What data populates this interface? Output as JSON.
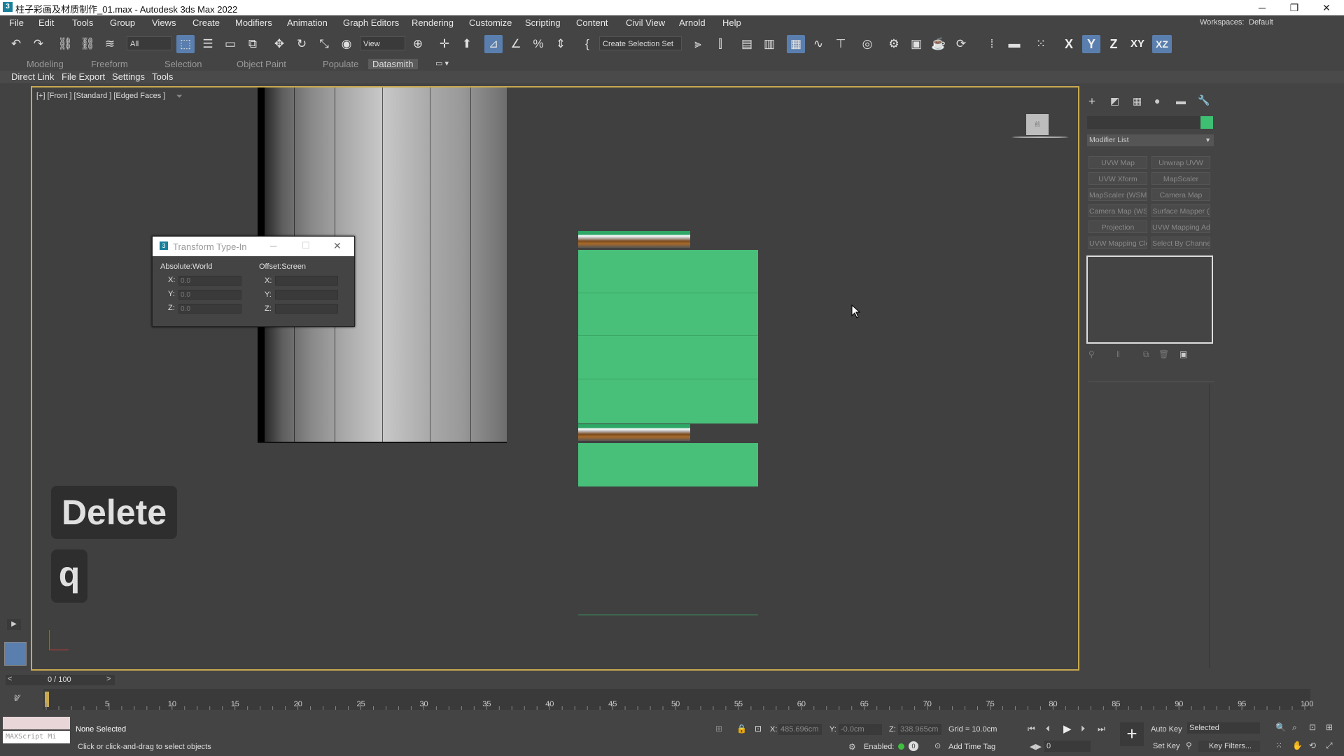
{
  "window": {
    "title": "柱子彩画及材质制作_01.max - Autodesk 3ds Max 2022",
    "app_icon": "3",
    "minimize": "─",
    "restore": "❐",
    "close": "✕"
  },
  "menubar": {
    "items": [
      "File",
      "Edit",
      "Tools",
      "Group",
      "Views",
      "Create",
      "Modifiers",
      "Animation",
      "Graph Editors",
      "Rendering",
      "Customize",
      "Scripting",
      "Content",
      "Civil View",
      "Arnold",
      "Help"
    ],
    "workspaces_label": "Workspaces:",
    "workspaces_value": "Default"
  },
  "toolbar": {
    "filter_value": "All",
    "view_value": "View",
    "selection_set_placeholder": "Create Selection Set",
    "axes": [
      "X",
      "Y",
      "Z",
      "XY",
      "XZ"
    ]
  },
  "ribbon": {
    "tabs": [
      "Modeling",
      "Freeform",
      "Selection",
      "Object Paint",
      "Populate",
      "Datasmith"
    ],
    "active_tab": "Datasmith"
  },
  "subbar": {
    "items": [
      "Direct Link",
      "File Export",
      "Settings",
      "Tools"
    ]
  },
  "viewport": {
    "label": "[+] [Front ] [Standard ] [Edged Faces ]",
    "viewcube_label": "前"
  },
  "dialog": {
    "title": "Transform Type-In",
    "absolute_label": "Absolute:World",
    "offset_label": "Offset:Screen",
    "abs_x_label": "X:",
    "abs_y_label": "Y:",
    "abs_z_label": "Z:",
    "abs_x": "0.0",
    "abs_y": "0.0",
    "abs_z": "0.0",
    "off_x_label": "X:",
    "off_y_label": "Y:",
    "off_z_label": "Z:"
  },
  "keys": {
    "key1": "Delete",
    "key2": "q"
  },
  "command_panel": {
    "modifier_list": "Modifier List",
    "object_color": "#3fbf72",
    "buttons": [
      "UVW Map",
      "Unwrap UVW",
      "UVW Xform",
      "MapScaler",
      "MapScaler (WSM)",
      "Camera Map",
      "Camera Map (WSM)",
      "Surface Mapper (",
      "Projection",
      "UVW Mapping Add",
      "UVW Mapping Clear",
      "Select By Channel"
    ]
  },
  "timeline": {
    "frame_display": "0 / 100",
    "prev": "<",
    "next": ">",
    "ticks": [
      "0",
      "5",
      "10",
      "15",
      "20",
      "25",
      "30",
      "35",
      "40",
      "45",
      "50",
      "55",
      "60",
      "65",
      "70",
      "75",
      "80",
      "85",
      "90",
      "95",
      "100"
    ]
  },
  "statusbar": {
    "maxscript": "MAXScript Mi",
    "selection_status": "None Selected",
    "prompt": "Click or click-and-drag to select objects",
    "x_label": "X:",
    "x_value": "485.696cm",
    "y_label": "Y:",
    "y_value": "-0.0cm",
    "z_label": "Z:",
    "z_value": "338.965cm",
    "grid": "Grid = 10.0cm",
    "enabled_label": "Enabled:",
    "add_time_tag": "Add Time Tag",
    "auto_key": "Auto Key",
    "set_key": "Set Key",
    "selected_dropdown": "Selected",
    "key_filters": "Key Filters...",
    "frame_field": "0"
  },
  "colors": {
    "viewport_border": "#c9a94f",
    "green_object": "#48c07a",
    "active_tool": "#5a7fae"
  }
}
